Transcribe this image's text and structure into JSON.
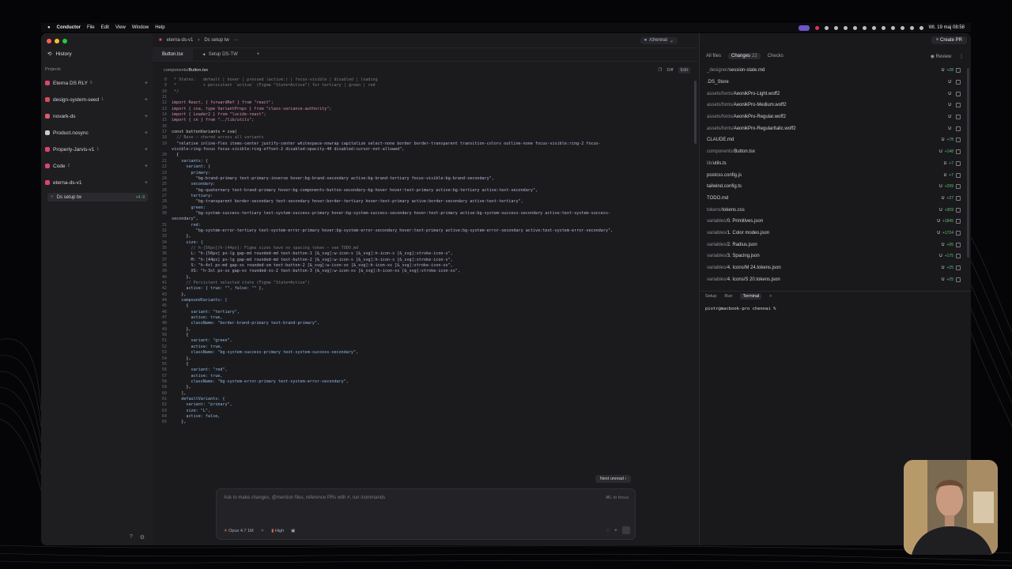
{
  "menubar": {
    "app": "Conductor",
    "items": [
      "File",
      "Edit",
      "View",
      "Window",
      "Help"
    ],
    "clock": "Wt. 19 maj  08:58"
  },
  "sidebar": {
    "history": "History",
    "projects_label": "Projects",
    "projects": [
      {
        "name": "Eterna DS RLY",
        "count": "5",
        "color": "#e0446a"
      },
      {
        "name": "design-system-seed",
        "count": "1",
        "color": "#d94d5a"
      },
      {
        "name": "novark-ds",
        "count": "",
        "color": "#e05a6e"
      },
      {
        "name": "Product.nosync",
        "count": "",
        "color": "#c9c9cf"
      },
      {
        "name": "Properly-Jarvis-v1",
        "count": "1",
        "color": "#e0446a"
      },
      {
        "name": "Code",
        "count": "2",
        "color": "#e0446a"
      },
      {
        "name": "eterna-ds-v1",
        "count": "",
        "color": "#e0446a"
      }
    ],
    "workspace": {
      "name": "Ds setup tw",
      "delta": "+4 -9"
    }
  },
  "topbar": {
    "crumbs": [
      "eterna-ds-v1",
      "Ds setup tw"
    ],
    "branch": "/chennai"
  },
  "tabs": [
    "Button.tsx",
    "Setup DS-TW"
  ],
  "filebar": {
    "path_dir": "components/",
    "path_file": "Button.tsx",
    "diff": "Diff",
    "edit": "Edit"
  },
  "code": [
    {
      "n": "8",
      "c": " * States:   default | hover | pressed (active:) | focus-visible | disabled | loading",
      "t": "cm"
    },
    {
      "n": "9",
      "c": " *           + persistent `active` (Figma \"State=Active\") for tertiary | green | red",
      "t": "cm"
    },
    {
      "n": "10",
      "c": " */",
      "t": "cm"
    },
    {
      "n": "11",
      "c": "",
      "t": ""
    },
    {
      "n": "12",
      "c": "import React, { forwardRef } from \"react\";",
      "t": "kw"
    },
    {
      "n": "13",
      "c": "import { cva, type VariantProps } from \"class-variance-authority\";",
      "t": "kw"
    },
    {
      "n": "14",
      "c": "import { Loader2 } from \"lucide-react\";",
      "t": "kw"
    },
    {
      "n": "15",
      "c": "import { cn } from \"../lib/utils\";",
      "t": "kw"
    },
    {
      "n": "16",
      "c": "",
      "t": ""
    },
    {
      "n": "17",
      "c": "const buttonVariants = cva(",
      "t": ""
    },
    {
      "n": "18",
      "c": "  // Base — shared across all variants",
      "t": "cm"
    },
    {
      "n": "19",
      "c": "  \"relative inline-flex items-center justify-center whitespace-nowrap capitalize select-none border border-transparent transition-colors outline-none focus-visible:ring-2 focus-",
      "t": "str"
    },
    {
      "n": "",
      "c": "visible:ring-focus focus-visible:ring-offset-2 disabled:opacity-40 disabled:cursor-not-allowed\",",
      "t": "str"
    },
    {
      "n": "20",
      "c": "  {",
      "t": ""
    },
    {
      "n": "21",
      "c": "    variants: {",
      "t": "prop"
    },
    {
      "n": "22",
      "c": "      variant: {",
      "t": "prop"
    },
    {
      "n": "23",
      "c": "        primary:",
      "t": "prop"
    },
    {
      "n": "24",
      "c": "          \"bg-brand-primary text-primary-inverse hover:bg-brand-secondary active:bg-brand-tertiary focus-visible:bg-brand-secondary\",",
      "t": "str"
    },
    {
      "n": "25",
      "c": "        secondary:",
      "t": "prop"
    },
    {
      "n": "26",
      "c": "          \"bg-quaternary text-brand-primary hover:bg-components-button-secondary-bg-hover hover:text-primary active:bg-tertiary active:text-secondary\",",
      "t": "str"
    },
    {
      "n": "27",
      "c": "        tertiary:",
      "t": "prop"
    },
    {
      "n": "28",
      "c": "          \"bg-transparent border-secondary text-secondary hover:border-tertiary hover:text-primary active:border-secondary active:text-tertiary\",",
      "t": "str"
    },
    {
      "n": "29",
      "c": "        green:",
      "t": "prop"
    },
    {
      "n": "30",
      "c": "          \"bg-system-success-tertiary text-system-success-primary hover:bg-system-success-secondary hover:text-primary active:bg-system-success-secondary active:text-system-success-",
      "t": "str"
    },
    {
      "n": "",
      "c": "secondary\",",
      "t": "str"
    },
    {
      "n": "31",
      "c": "        red:",
      "t": "prop"
    },
    {
      "n": "32",
      "c": "          \"bg-system-error-tertiary text-system-error-primary hover:bg-system-error-secondary hover:text-primary active:bg-system-error-secondary active:text-system-error-secondary\",",
      "t": "str"
    },
    {
      "n": "33",
      "c": "      },",
      "t": ""
    },
    {
      "n": "34",
      "c": "      size: {",
      "t": "prop"
    },
    {
      "n": "35",
      "c": "        // h-[56px]/h-[44px]: Figma sizes have no spacing token — see TODO.md",
      "t": "cm"
    },
    {
      "n": "36",
      "c": "        L: \"h-[56px] px-lg gap-md rounded-md text-button-1 [&_svg]:w-icon-s [&_svg]:h-icon-s [&_svg]:stroke-icon-s\",",
      "t": "str"
    },
    {
      "n": "37",
      "c": "        M: \"h-[44px] px-lg gap-md rounded-md text-button-2 [&_svg]:w-icon-s [&_svg]:h-icon-s [&_svg]:stroke-icon-s\",",
      "t": "str"
    },
    {
      "n": "38",
      "c": "        S: \"h-4xl px-md gap-xs rounded-sm text-button-2 [&_svg]:w-icon-xs [&_svg]:h-icon-xs [&_svg]:stroke-icon-xs\",",
      "t": "str"
    },
    {
      "n": "39",
      "c": "        XS: \"h-3xl px-xs gap-xs rounded-xs-2 text-button-3 [&_svg]:w-icon-xs [&_svg]:h-icon-xs [&_svg]:stroke-icon-xs\",",
      "t": "str"
    },
    {
      "n": "40",
      "c": "      },",
      "t": ""
    },
    {
      "n": "41",
      "c": "      // Persistent selected state (Figma \"State=Active\")",
      "t": "cm"
    },
    {
      "n": "42",
      "c": "      active: { true: \"\", false: \"\" },",
      "t": "prop"
    },
    {
      "n": "43",
      "c": "    },",
      "t": ""
    },
    {
      "n": "44",
      "c": "    compoundVariants: [",
      "t": "prop"
    },
    {
      "n": "45",
      "c": "      {",
      "t": ""
    },
    {
      "n": "46",
      "c": "        variant: \"tertiary\",",
      "t": "prop"
    },
    {
      "n": "47",
      "c": "        active: true,",
      "t": "prop"
    },
    {
      "n": "48",
      "c": "        className: \"border-brand-primary text-brand-primary\",",
      "t": "prop"
    },
    {
      "n": "49",
      "c": "      },",
      "t": ""
    },
    {
      "n": "50",
      "c": "      {",
      "t": ""
    },
    {
      "n": "51",
      "c": "        variant: \"green\",",
      "t": "prop"
    },
    {
      "n": "52",
      "c": "        active: true,",
      "t": "prop"
    },
    {
      "n": "53",
      "c": "        className: \"bg-system-success-primary text-system-success-secondary\",",
      "t": "prop"
    },
    {
      "n": "54",
      "c": "      },",
      "t": ""
    },
    {
      "n": "55",
      "c": "      {",
      "t": ""
    },
    {
      "n": "56",
      "c": "        variant: \"red\",",
      "t": "prop"
    },
    {
      "n": "57",
      "c": "        active: true,",
      "t": "prop"
    },
    {
      "n": "58",
      "c": "        className: \"bg-system-error-primary text-system-error-secondary\",",
      "t": "prop"
    },
    {
      "n": "59",
      "c": "      },",
      "t": ""
    },
    {
      "n": "60",
      "c": "    ],",
      "t": ""
    },
    {
      "n": "61",
      "c": "    defaultVariants: {",
      "t": "prop"
    },
    {
      "n": "62",
      "c": "      variant: \"primary\",",
      "t": "prop"
    },
    {
      "n": "63",
      "c": "      size: \"L\",",
      "t": "prop"
    },
    {
      "n": "64",
      "c": "      active: false,",
      "t": "prop"
    },
    {
      "n": "65",
      "c": "    },",
      "t": ""
    }
  ],
  "next_unread": "Next unread",
  "composer": {
    "placeholder": "Ask to make changes, @mention files, reference PRs with #, run /commands",
    "focus_hint": "⌘L to focus",
    "model": "Opus 4.7 1M",
    "effort": "High"
  },
  "right_panel": {
    "create_pr": "Create PR",
    "tabs": {
      "all_files": "All files",
      "changes": "Changes",
      "changes_count": "22",
      "checks": "Checks",
      "review": "Review"
    },
    "files": [
      {
        "dir": "_designer/",
        "name": "session-state.md",
        "status": "U",
        "delta": "+28"
      },
      {
        "dir": "",
        "name": ".DS_Store",
        "status": "U",
        "delta": ""
      },
      {
        "dir": "assets/fonts/",
        "name": "AeonikPro-Light.woff2",
        "status": "U",
        "delta": ""
      },
      {
        "dir": "assets/fonts/",
        "name": "AeonikPro-Medium.woff2",
        "status": "U",
        "delta": ""
      },
      {
        "dir": "assets/fonts/",
        "name": "AeonikPro-Regular.woff2",
        "status": "U",
        "delta": ""
      },
      {
        "dir": "assets/fonts/",
        "name": "AeonikPro-RegularItalic.woff2",
        "status": "U",
        "delta": ""
      },
      {
        "dir": "",
        "name": "CLAUDE.md",
        "status": "U",
        "delta": "+78"
      },
      {
        "dir": "components/",
        "name": "Button.tsx",
        "status": "U",
        "delta": "+148"
      },
      {
        "dir": "lib/",
        "name": "utils.ts",
        "status": "U",
        "delta": "+7"
      },
      {
        "dir": "",
        "name": "postcss.config.js",
        "status": "U",
        "delta": "+7"
      },
      {
        "dir": "",
        "name": "tailwind.config.ts",
        "status": "U",
        "delta": "+299"
      },
      {
        "dir": "",
        "name": "TODO.md",
        "status": "U",
        "delta": "+27"
      },
      {
        "dir": "tokens/",
        "name": "tokens.css",
        "status": "U",
        "delta": "+359"
      },
      {
        "dir": "variables/",
        "name": "0. Primitives.json",
        "status": "U",
        "delta": "+1845"
      },
      {
        "dir": "variables/",
        "name": "1. Color modes.json",
        "status": "U",
        "delta": "+1724"
      },
      {
        "dir": "variables/",
        "name": "2. Radius.json",
        "status": "U",
        "delta": "+95"
      },
      {
        "dir": "variables/",
        "name": "3. Spacing.json",
        "status": "U",
        "delta": "+175"
      },
      {
        "dir": "variables/",
        "name": "4. Icons/M 24.tokens.json",
        "status": "U",
        "delta": "+25"
      },
      {
        "dir": "variables/",
        "name": "4. Icons/S 20.tokens.json",
        "status": "U",
        "delta": "+25"
      }
    ],
    "terminal_tabs": [
      "Setup",
      "Run",
      "Terminal"
    ],
    "terminal_prompt": "piotr@macbook-pro chennai %"
  }
}
